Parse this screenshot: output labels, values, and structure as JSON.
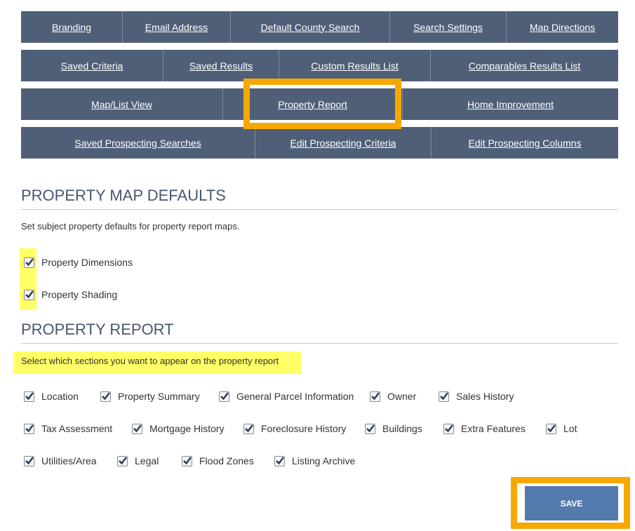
{
  "nav": {
    "row1": [
      "Branding",
      "Email Address",
      "Default County Search",
      "Search Settings",
      "Map Directions"
    ],
    "row2": [
      "Saved Criteria",
      "Saved Results",
      "Custom Results List",
      "Comparables Results List"
    ],
    "row3": [
      "Map/List View",
      "Property Report",
      "Home Improvement"
    ],
    "row4": [
      "Saved Prospecting Searches",
      "Edit Prospecting Criteria",
      "Edit Prospecting Columns"
    ]
  },
  "map_defaults": {
    "title": "PROPERTY MAP DEFAULTS",
    "description": "Set subject property defaults for property report maps.",
    "options": [
      {
        "label": "Property Dimensions",
        "checked": true
      },
      {
        "label": "Property Shading",
        "checked": true
      }
    ]
  },
  "report": {
    "title": "PROPERTY REPORT",
    "description": "Select which sections you want to appear on the property report",
    "sections": [
      {
        "label": "Location",
        "checked": true
      },
      {
        "label": "Property Summary",
        "checked": true
      },
      {
        "label": "General Parcel Information",
        "checked": true
      },
      {
        "label": "Owner",
        "checked": true
      },
      {
        "label": "Sales History",
        "checked": true
      },
      {
        "label": "Tax Assessment",
        "checked": true
      },
      {
        "label": "Mortgage History",
        "checked": true
      },
      {
        "label": "Foreclosure History",
        "checked": true
      },
      {
        "label": "Buildings",
        "checked": true
      },
      {
        "label": "Extra Features",
        "checked": true
      },
      {
        "label": "Lot",
        "checked": true
      },
      {
        "label": "Utilities/Area",
        "checked": true
      },
      {
        "label": "Legal",
        "checked": true
      },
      {
        "label": "Flood Zones",
        "checked": true
      },
      {
        "label": "Listing Archive",
        "checked": true
      }
    ]
  },
  "save_label": "SAVE",
  "colors": {
    "nav_bg": "#4f5f78",
    "save_bg": "#5479ac",
    "highlight_orange": "#f7a800",
    "highlight_yellow": "#ffff66",
    "heading": "#4a5570"
  }
}
